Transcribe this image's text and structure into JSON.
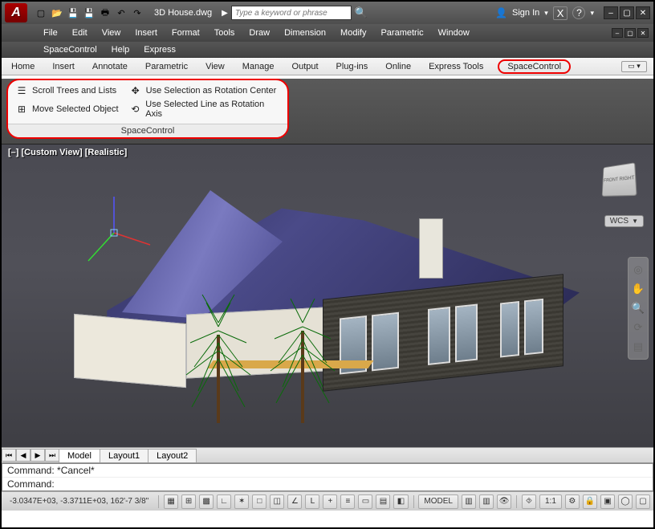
{
  "title": {
    "doc": "3D House.dwg"
  },
  "search": {
    "placeholder": "Type a keyword or phrase"
  },
  "signin": {
    "label": "Sign In"
  },
  "menu1": [
    "File",
    "Edit",
    "View",
    "Insert",
    "Format",
    "Tools",
    "Draw",
    "Dimension",
    "Modify",
    "Parametric",
    "Window"
  ],
  "menu2": [
    "SpaceControl",
    "Help",
    "Express"
  ],
  "ribbonTabs": [
    "Home",
    "Insert",
    "Annotate",
    "Parametric",
    "View",
    "Manage",
    "Output",
    "Plug-ins",
    "Online",
    "Express Tools",
    "SpaceControl"
  ],
  "panel": {
    "title": "SpaceControl",
    "items": [
      "Scroll Trees and Lists",
      "Use Selection as Rotation Center",
      "Move Selected Object",
      "Use Selected Line as Rotation Axis"
    ]
  },
  "viewLabel": "[–] [Custom View] [Realistic]",
  "wcs": "WCS",
  "viewcube": "FRONT RIGHT",
  "layoutTabs": {
    "active": "Model",
    "others": [
      "Layout1",
      "Layout2"
    ]
  },
  "command": {
    "line1": "Command: *Cancel*",
    "line2": "Command:"
  },
  "status": {
    "coords": "-3.0347E+03, -3.3711E+03, 162'-7 3/8\"",
    "model": "MODEL",
    "scale": "1:1"
  }
}
